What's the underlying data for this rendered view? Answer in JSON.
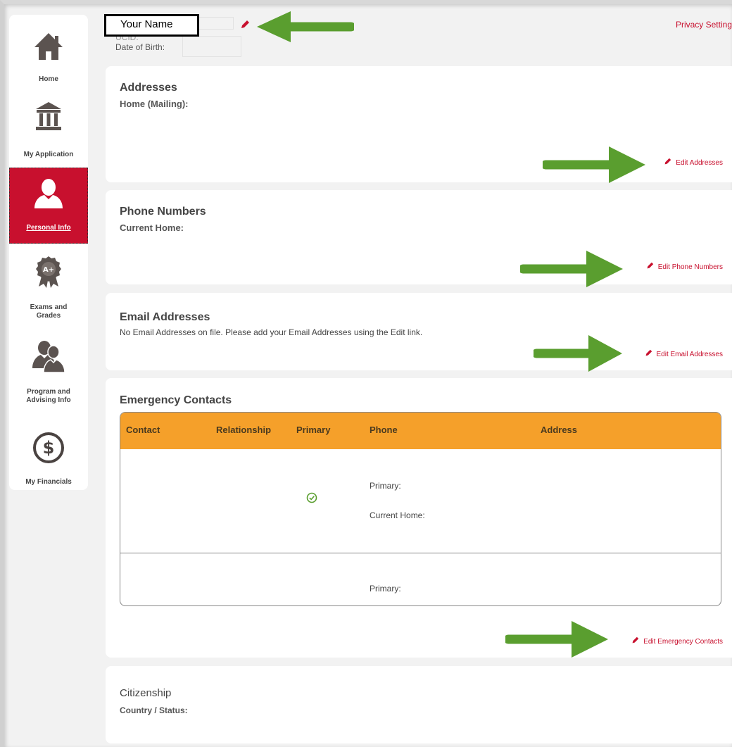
{
  "header": {
    "name": "Your Name",
    "ucid_label": "UCID:",
    "dob_label": "Date of Birth:",
    "privacy_label": "Privacy Settings"
  },
  "sidebar": {
    "items": [
      {
        "label": "Home",
        "icon": "house-icon"
      },
      {
        "label": "My Application",
        "icon": "institution-icon"
      },
      {
        "label": "Personal Info",
        "icon": "person-icon",
        "active": true
      },
      {
        "label": "Exams and Grades",
        "icon": "award-ribbon-icon"
      },
      {
        "label": "Program and Advising Info",
        "icon": "people-icon"
      },
      {
        "label": "My Financials",
        "icon": "dollar-circle-icon"
      }
    ]
  },
  "addresses": {
    "title": "Addresses",
    "home_label": "Home (Mailing):",
    "edit_label": "Edit Addresses"
  },
  "phones": {
    "title": "Phone Numbers",
    "home_label": "Current Home:",
    "edit_label": "Edit Phone Numbers"
  },
  "emails": {
    "title": "Email Addresses",
    "message": "No Email Addresses on file. Please add your Email Addresses using the Edit link.",
    "edit_label": "Edit Email Addresses"
  },
  "emergency": {
    "title": "Emergency Contacts",
    "columns": [
      "Contact",
      "Relationship",
      "Primary",
      "Phone",
      "Address"
    ],
    "rows": [
      {
        "primary": true,
        "phones": [
          "Primary:",
          "Current Home:"
        ]
      },
      {
        "primary": false,
        "phones": [
          "Primary:"
        ]
      }
    ],
    "edit_label": "Edit Emergency Contacts"
  },
  "citizenship": {
    "title": "Citizenship",
    "status_label": "Country / Status:"
  },
  "colors": {
    "accent": "#c8102e",
    "table_header": "#f5a02a",
    "annotation_arrow": "#5a9e2f"
  }
}
